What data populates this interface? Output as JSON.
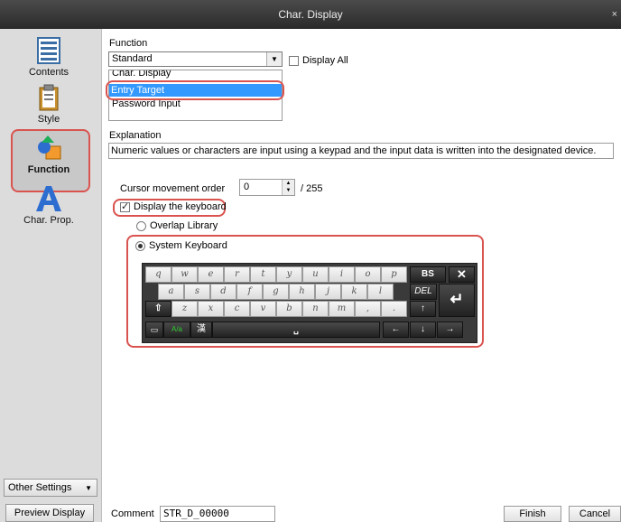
{
  "window": {
    "title": "Char. Display",
    "close_glyph": "×"
  },
  "sidebar": {
    "items": [
      {
        "label": "Contents",
        "icon": "list-icon"
      },
      {
        "label": "Style",
        "icon": "clipboard-icon"
      },
      {
        "label": "Function",
        "icon": "shapes-icon",
        "selected": true
      },
      {
        "label": "Char. Prop.",
        "icon": "letter-a-icon"
      }
    ],
    "other_settings": "Other Settings",
    "preview_display": "Preview Display"
  },
  "function": {
    "label": "Function",
    "selected": "Standard",
    "display_all": "Display All",
    "display_all_checked": false,
    "list": [
      "Char. Display",
      "Entry Target",
      "Password Input"
    ],
    "list_selected": "Entry Target"
  },
  "explanation": {
    "label": "Explanation",
    "text": "Numeric values or characters are input using a keypad and the input data is written into the designated device."
  },
  "cursor": {
    "label": "Cursor movement order",
    "value": "0",
    "max": "/ 255"
  },
  "keyboard": {
    "display_label": "Display the keyboard",
    "display_checked": true,
    "overlap_label": "Overlap Library",
    "system_label": "System Keyboard",
    "system_selected": true,
    "row1": [
      "q",
      "w",
      "e",
      "r",
      "t",
      "y",
      "u",
      "i",
      "o",
      "p"
    ],
    "row2": [
      "a",
      "s",
      "d",
      "f",
      "g",
      "h",
      "j",
      "k",
      "l"
    ],
    "row3": [
      "z",
      "x",
      "c",
      "v",
      "b",
      "n",
      "m",
      ",",
      "."
    ],
    "bs": "BS",
    "del": "DEL",
    "clr": "CLR",
    "aa": "A/a",
    "hz": "漢"
  },
  "comment": {
    "label": "Comment",
    "value": "STR_D_00000"
  },
  "buttons": {
    "finish": "Finish",
    "cancel": "Cancel"
  },
  "colors": {
    "highlight": "#d9534f",
    "selection": "#3399ff",
    "titlebar": "#333333"
  }
}
